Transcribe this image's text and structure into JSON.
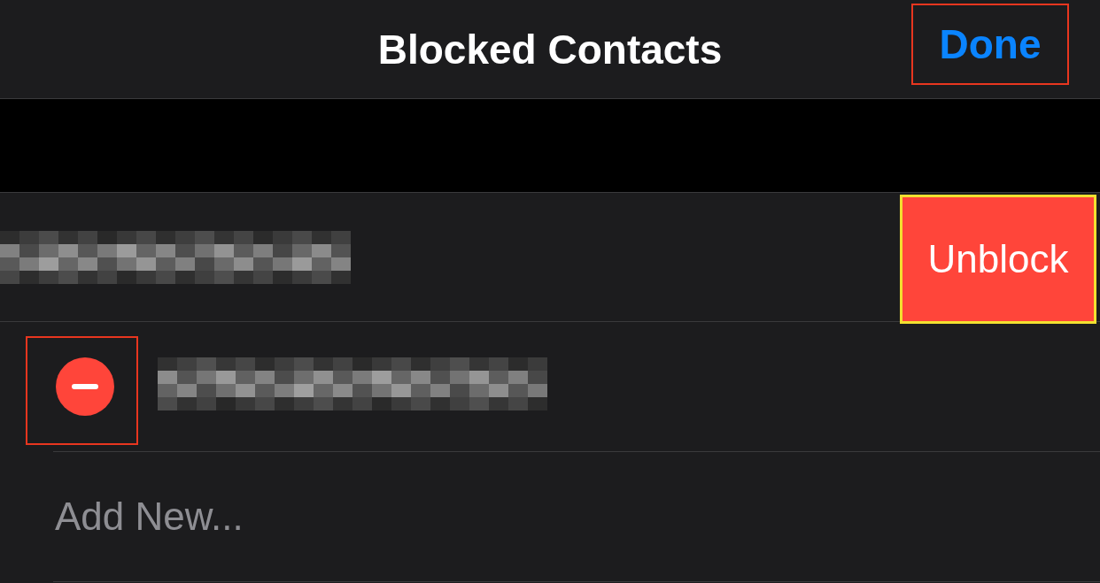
{
  "nav": {
    "title": "Blocked Contacts",
    "done": "Done",
    "done_frame": {
      "color": "#e8361f"
    }
  },
  "contacts": [
    {
      "kind": "swiped",
      "action": "Unblock",
      "action_frame": {
        "color": "#f2e030"
      }
    },
    {
      "kind": "editing",
      "control_frame": {
        "color": "#e8361f"
      }
    }
  ],
  "add_new": "Add New..."
}
